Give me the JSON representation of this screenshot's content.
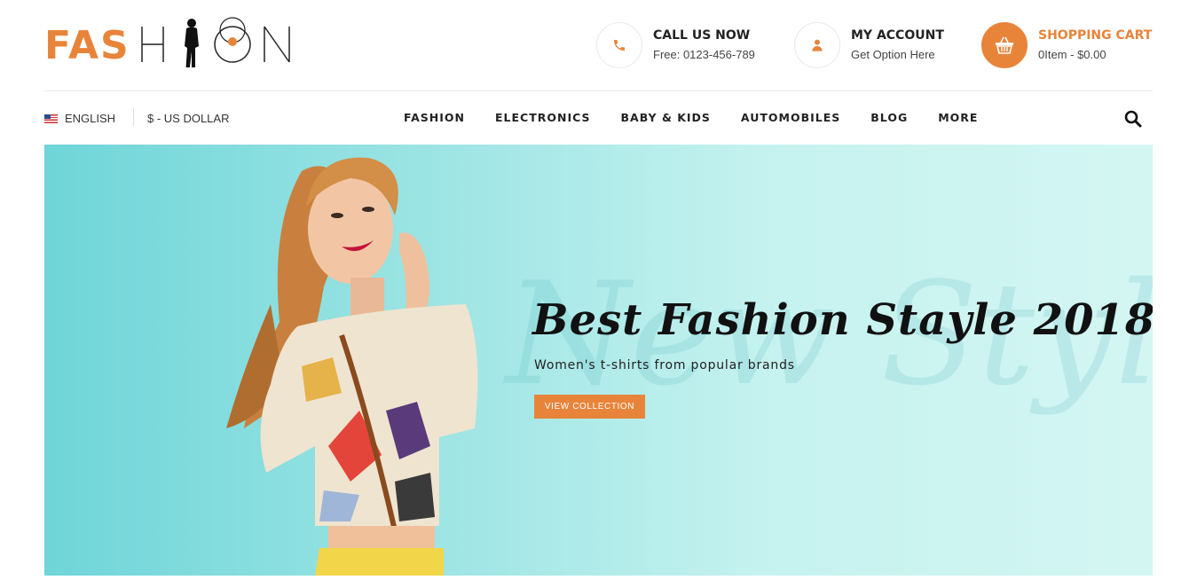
{
  "logo": {
    "text_colored": "FAS",
    "text_outline": "HION",
    "brand_color": "#e8843a"
  },
  "header": {
    "call": {
      "icon": "phone-icon",
      "title": "CALL US NOW",
      "subtitle": "Free: 0123-456-789"
    },
    "account": {
      "icon": "user-icon",
      "title": "MY ACCOUNT",
      "subtitle": "Get Option Here"
    },
    "cart": {
      "icon": "basket-icon",
      "title": "SHOPPING CART",
      "subtitle": "0Item - $0.00"
    }
  },
  "topbar": {
    "language": "ENGLISH",
    "language_icon": "us-flag-icon",
    "currency": "$ - US DOLLAR"
  },
  "menu": {
    "items": [
      "FASHION",
      "ELECTRONICS",
      "BABY & KIDS",
      "AUTOMOBILES",
      "BLOG",
      "MORE"
    ],
    "search_icon": "search-icon"
  },
  "hero": {
    "watermark": "New Style",
    "title": "Best Fashion Stayle 2018",
    "subtitle": "Women's t-shirts from popular brands",
    "button_label": "VIEW COLLECTION",
    "background_color": "#a9ecea"
  }
}
